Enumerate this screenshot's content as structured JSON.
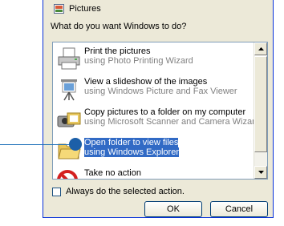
{
  "dialog": {
    "file_type_label": "Pictures",
    "question": "What do you want Windows to do?",
    "items": [
      {
        "title": "Print the pictures",
        "subtitle": "using Photo Printing Wizard",
        "icon": "printer-icon"
      },
      {
        "title": "View a slideshow of the images",
        "subtitle": "using Windows Picture and Fax Viewer",
        "icon": "slideshow-icon"
      },
      {
        "title": "Copy pictures to a folder on my computer",
        "subtitle": "using Microsoft Scanner and Camera Wizard",
        "icon": "camera-icon"
      },
      {
        "title": "Open folder to view files",
        "subtitle": "using Windows Explorer",
        "icon": "folder-icon",
        "selected": true
      },
      {
        "title": "Take no action",
        "subtitle": "",
        "icon": "no-action-icon"
      }
    ],
    "checkbox_label": "Always do the selected action.",
    "checkbox_checked": false,
    "ok_label": "OK",
    "cancel_label": "Cancel"
  },
  "colors": {
    "selection": "#316ac5",
    "callout": "#1c5fa8",
    "dialog_bg": "#ece9d8"
  }
}
